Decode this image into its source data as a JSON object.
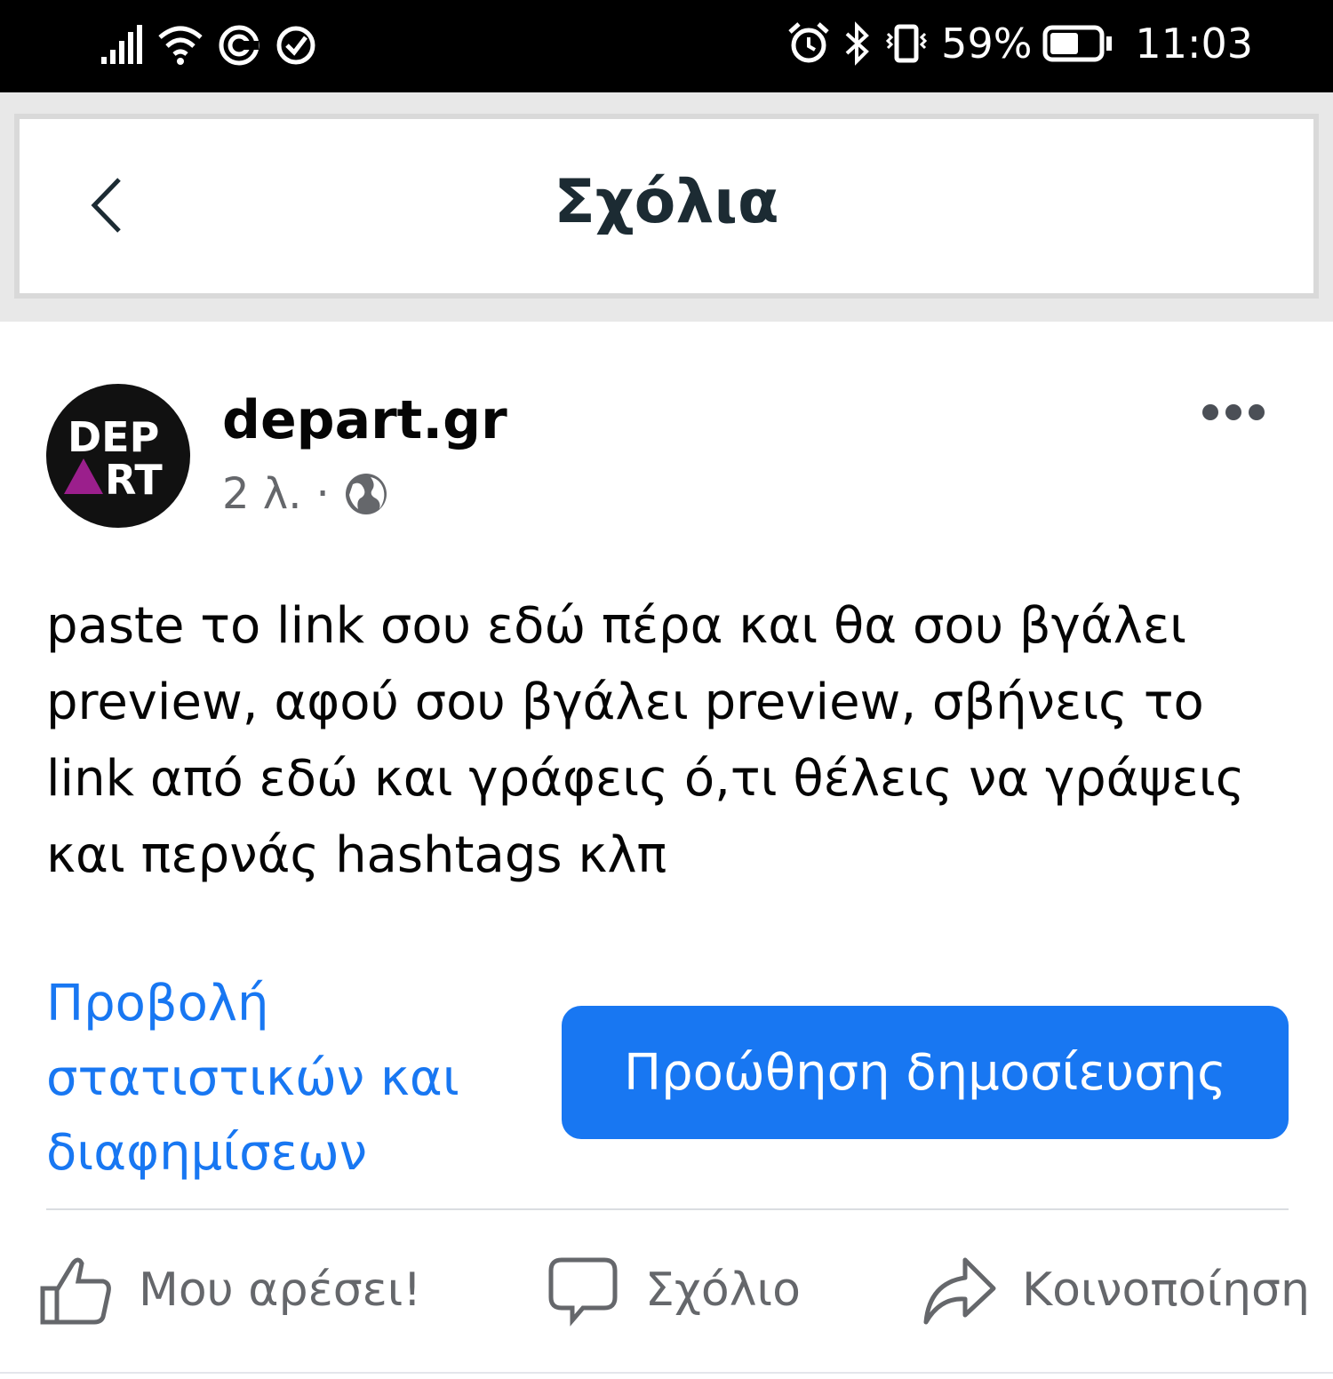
{
  "status_bar": {
    "battery_percent": "59%",
    "time": "11:03",
    "battery_level": 0.59
  },
  "header": {
    "title": "Σχόλια"
  },
  "post": {
    "page_name": "depart.gr",
    "time_ago": "2 λ.",
    "separator": "·",
    "avatar_text_top": "DEP",
    "avatar_text_bottom": "RT",
    "text": "paste το link σου εδώ πέρα και θα σου βγάλει preview, αφού σου βγάλει preview, σβήνεις το link από εδώ και γράφεις ό,τι θέλεις να γράψεις και περνάς hashtags κλπ",
    "insights_link": "Προβολή στατιστικών και διαφημίσεων",
    "boost_button": "Προώθηση δημοσίευσης"
  },
  "actions": {
    "like": "Μου αρέσει!",
    "comment": "Σχόλιο",
    "share": "Κοινοποίηση"
  },
  "colors": {
    "accent": "#1877f2",
    "avatar_triangle": "#9b1f8c"
  }
}
